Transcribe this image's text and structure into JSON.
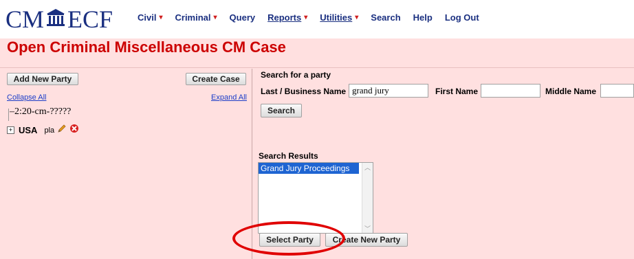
{
  "app": {
    "logo_left": "CM",
    "logo_right": "ECF"
  },
  "menu": [
    {
      "label": "Civil",
      "has_caret": true
    },
    {
      "label": "Criminal",
      "has_caret": true
    },
    {
      "label": "Query",
      "has_caret": false
    },
    {
      "label": "Reports",
      "has_caret": true
    },
    {
      "label": "Utilities",
      "has_caret": true
    },
    {
      "label": "Search",
      "has_caret": false
    },
    {
      "label": "Help",
      "has_caret": false
    },
    {
      "label": "Log Out",
      "has_caret": false
    }
  ],
  "page": {
    "title": "Open Criminal Miscellaneous CM Case"
  },
  "left_pane": {
    "add_new_party": "Add New Party",
    "create_case": "Create Case",
    "collapse_all": "Collapse All",
    "expand_all": "Expand All",
    "case_number": "2:20-cm-?????",
    "party": {
      "expand": "+",
      "name": "USA",
      "role": "pla"
    }
  },
  "search": {
    "heading": "Search for a party",
    "last_name_label": "Last / Business Name",
    "last_name_value": "grand jury",
    "first_name_label": "First Name",
    "first_name_value": "",
    "middle_name_label": "Middle Name",
    "middle_name_value": "",
    "search_button": "Search"
  },
  "results": {
    "heading": "Search Results",
    "items": [
      "Grand Jury Proceedings"
    ],
    "select_party": "Select Party",
    "create_new_party": "Create New Party"
  },
  "colors": {
    "brand": "#1a2f80",
    "title_red": "#cc0000",
    "background_pink": "#ffe0e0",
    "selection_blue": "#1e64d2",
    "annotation_ring": "#e00000"
  }
}
